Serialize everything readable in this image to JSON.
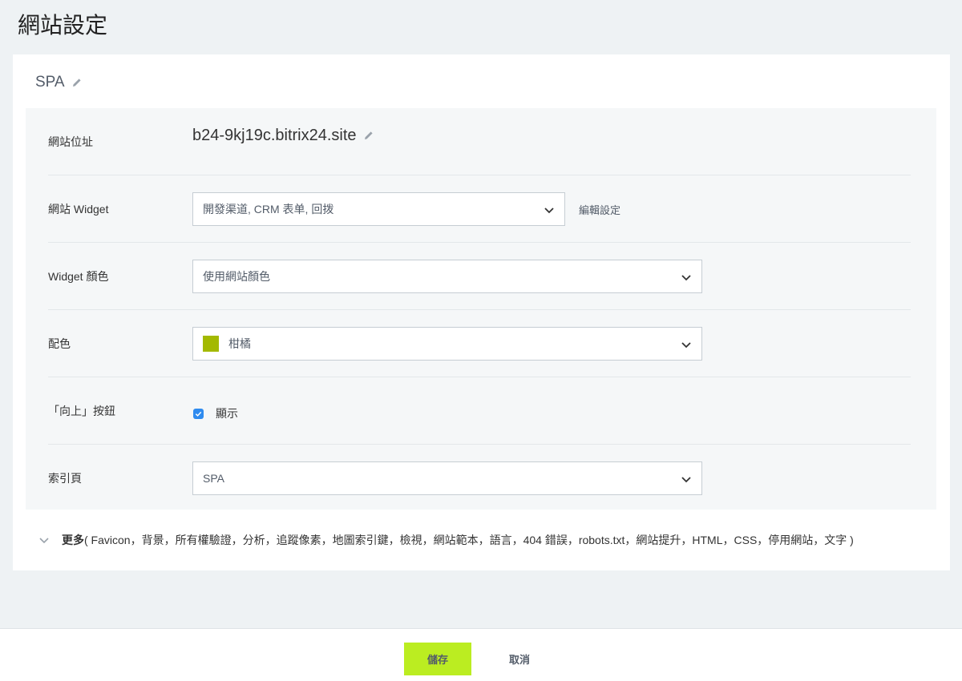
{
  "page": {
    "title": "網站設定"
  },
  "site": {
    "name": "SPA"
  },
  "settings": {
    "address": {
      "label": "網站位址",
      "value": "b24-9kj19c.bitrix24.site"
    },
    "widget": {
      "label": "網站 Widget",
      "value": "開發渠道, CRM 表单, 回拨",
      "edit_link": "編輯設定"
    },
    "widget_color": {
      "label": "Widget 顏色",
      "value": "使用網站顏色"
    },
    "color_scheme": {
      "label": "配色",
      "value": "柑橘",
      "swatch_color": "#a3b900"
    },
    "up_button": {
      "label": "「向上」按鈕",
      "checkbox_label": "顯示",
      "checked": true
    },
    "index_page": {
      "label": "索引頁",
      "value": "SPA"
    }
  },
  "more": {
    "label": "更多",
    "items": "( Favicon，背景，所有權驗證，分析，追蹤像素，地圖索引鍵，檢視，網站範本，語言，404 錯誤，robots.txt，網站提升，HTML，CSS，停用網站，文字 )"
  },
  "footer": {
    "save_label": "儲存",
    "cancel_label": "取消"
  },
  "colors": {
    "accent_save": "#bbed21",
    "checkbox": "#2f8bef",
    "background": "#eef2f4"
  }
}
